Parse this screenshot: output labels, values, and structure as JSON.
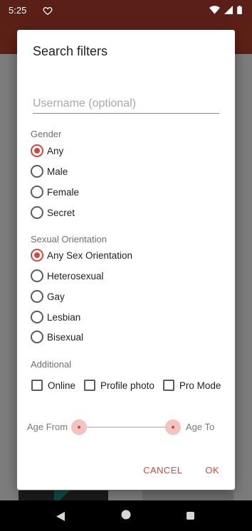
{
  "status_bar": {
    "time": "5:25"
  },
  "dialog": {
    "title": "Search filters",
    "username_placeholder": "Username (optional)",
    "gender": {
      "label": "Gender",
      "options": [
        "Any",
        "Male",
        "Female",
        "Secret"
      ],
      "selected": "Any"
    },
    "orientation": {
      "label": "Sexual Orientation",
      "options": [
        "Any Sex Orientation",
        "Heterosexual",
        "Gay",
        "Lesbian",
        "Bisexual"
      ],
      "selected": "Any Sex Orientation"
    },
    "additional": {
      "label": "Additional",
      "options": [
        "Online",
        "Profile photo",
        "Pro Mode"
      ]
    },
    "age": {
      "from_label": "Age From",
      "to_label": "Age To"
    },
    "actions": {
      "cancel": "CANCEL",
      "ok": "OK"
    }
  },
  "colors": {
    "accent": "#d8473a",
    "app_bar": "#5d2017"
  }
}
